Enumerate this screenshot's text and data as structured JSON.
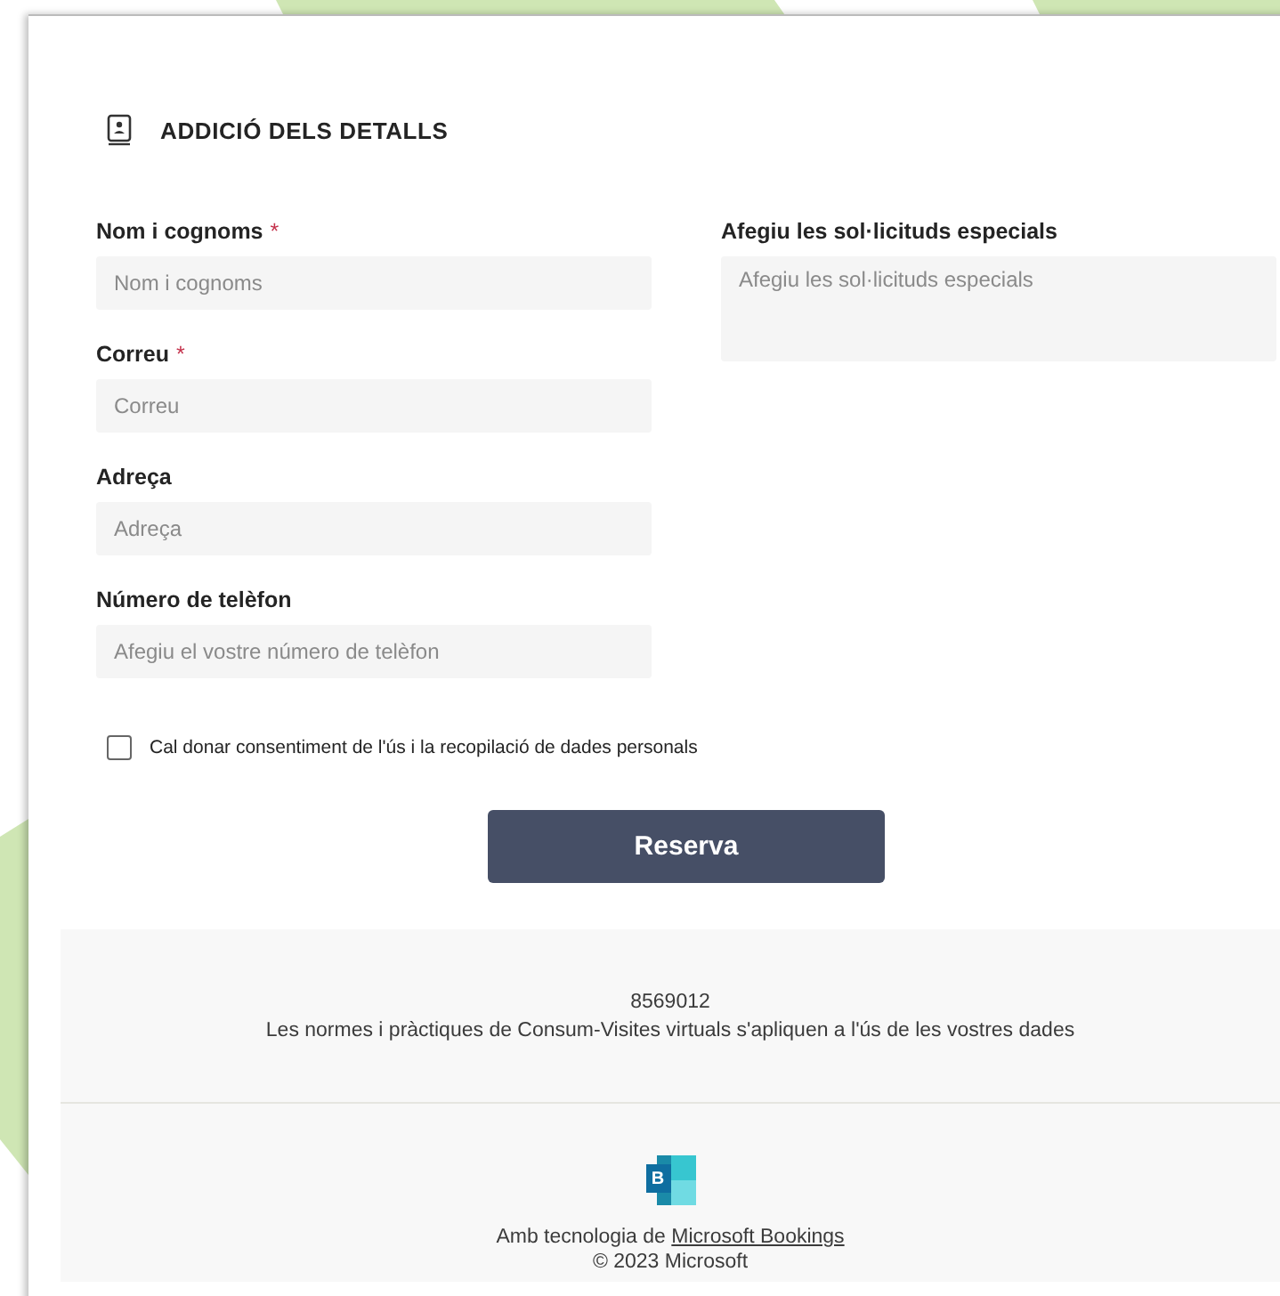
{
  "section": {
    "title": "ADDICIÓ DELS DETALLS"
  },
  "fields": [
    {
      "label": "Nom i cognoms",
      "required": true,
      "placeholder": "Nom i cognoms",
      "kind": "input"
    },
    {
      "label": "Correu",
      "required": true,
      "placeholder": "Correu",
      "kind": "input"
    },
    {
      "label": "Adreça",
      "required": false,
      "placeholder": "Adreça",
      "kind": "input"
    },
    {
      "label": "Número de telèfon",
      "required": false,
      "placeholder": "Afegiu el vostre número de telèfon",
      "kind": "input"
    }
  ],
  "special_requests": {
    "label": "Afegiu les sol·licituds especials",
    "placeholder": "Afegiu les sol·licituds especials",
    "kind": "textarea"
  },
  "required_mark": "*",
  "consent": {
    "label": "Cal donar consentiment de l'ús i la recopilació de dades personals",
    "checked": false
  },
  "submit_button": "Reserva",
  "footer": {
    "code": "8569012",
    "policy": "Les normes i pràctiques de Consum-Visites virtuals s'apliquen a l'ús de les vostres dades",
    "logo_letter": "B",
    "powered_by": "Amb tecnologia de",
    "powered_link": "Microsoft Bookings",
    "copyright": "© 2023 Microsoft"
  }
}
